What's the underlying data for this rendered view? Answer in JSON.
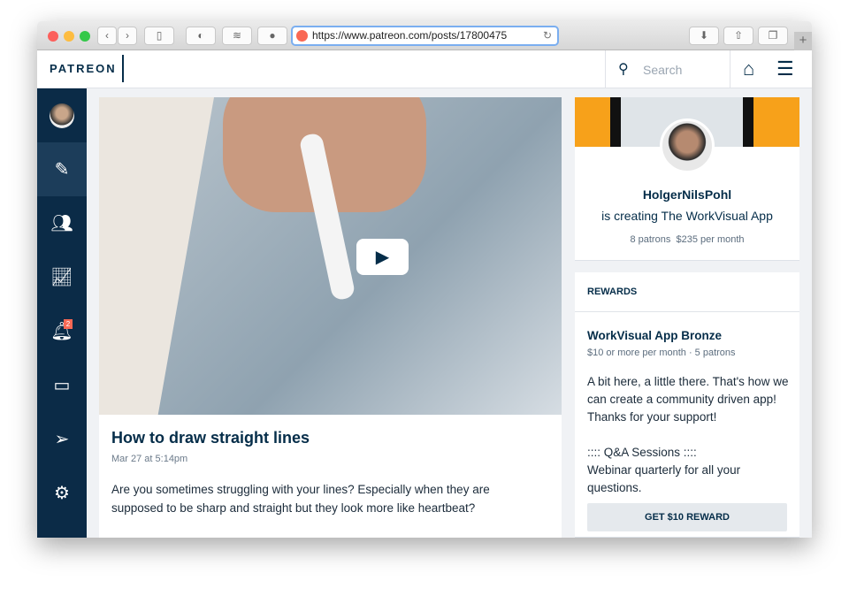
{
  "browser": {
    "url": "https://www.patreon.com/posts/17800475",
    "new_tab": "+"
  },
  "header": {
    "logo": "PATREON",
    "search_placeholder": "Search"
  },
  "sidebar": {
    "notification_count": "2"
  },
  "post": {
    "title": "How to draw straight lines",
    "date": "Mar 27 at 5:14pm",
    "body": "Are you sometimes struggling with your lines? Especially when they are supposed to be sharp and straight but they look more like heartbeat?"
  },
  "creator": {
    "name": "HolgerNilsPohl",
    "creating": "is creating The WorkVisual App",
    "patrons": "8 patrons",
    "earnings": "$235 per month"
  },
  "rewards": {
    "heading": "REWARDS",
    "tier": "WorkVisual App Bronze",
    "meta": "$10 or more per month · 5 patrons",
    "description": "A bit here, a little there. That's how we can create a community driven app! Thanks for your support!\n\n:::: Q&A Sessions ::::\nWebinar quarterly for all your questions.",
    "button": "GET $10 REWARD"
  },
  "colors": {
    "navy": "#052d49",
    "sidebar": "#0b2b47",
    "brand": "#f96854"
  }
}
